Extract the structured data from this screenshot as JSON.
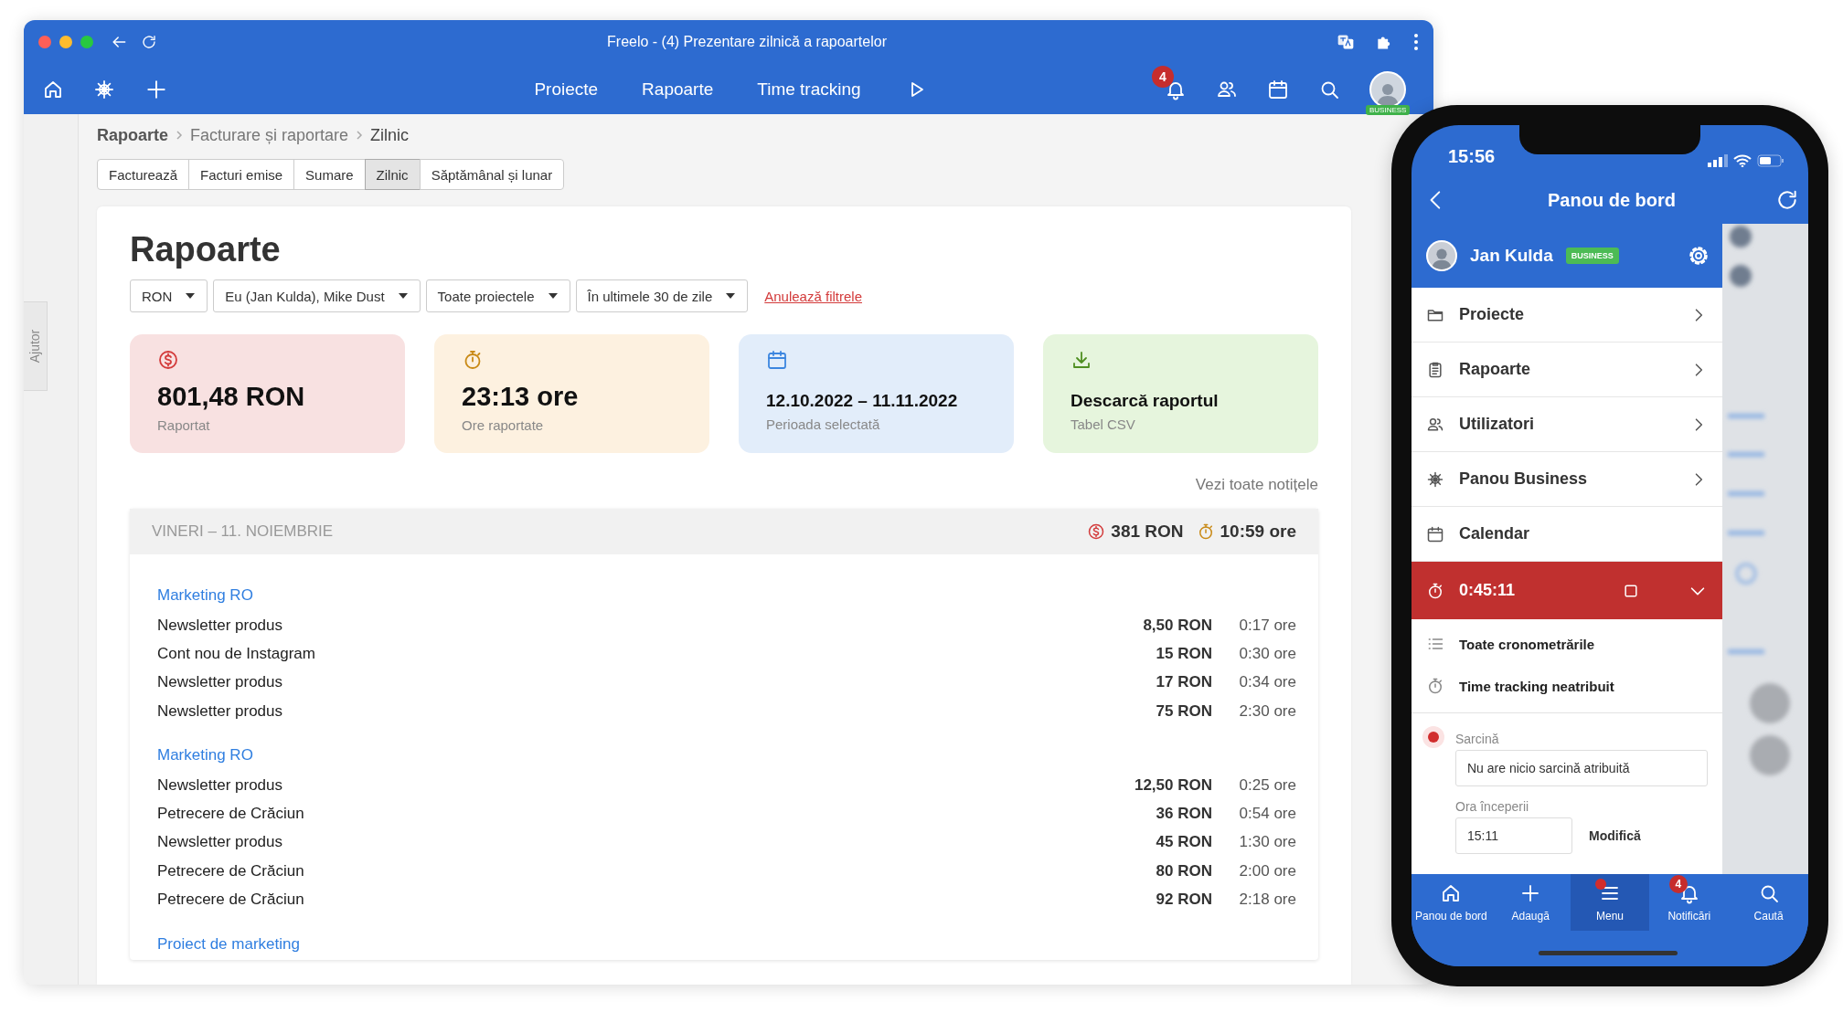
{
  "browser": {
    "title": "Freelo - (4) Prezentare zilnică a rapoartelor",
    "nav": [
      {
        "label": "Proiecte"
      },
      {
        "label": "Rapoarte"
      },
      {
        "label": "Time tracking"
      }
    ],
    "notification_badge": "4",
    "avatar_badge": "BUSINESS"
  },
  "help_tab": "Ajutor",
  "breadcrumb": [
    "Rapoarte",
    "Facturare și raportare",
    "Zilnic"
  ],
  "tabs": [
    {
      "label": "Facturează",
      "selected": false
    },
    {
      "label": "Facturi emise",
      "selected": false
    },
    {
      "label": "Sumare",
      "selected": false
    },
    {
      "label": "Zilnic",
      "selected": true
    },
    {
      "label": "Săptămânal și lunar",
      "selected": false
    }
  ],
  "page": {
    "title": "Rapoarte",
    "filters": [
      {
        "label": "RON"
      },
      {
        "label": "Eu (Jan Kulda), Mike Dust"
      },
      {
        "label": "Toate proiectele"
      },
      {
        "label": "În ultimele 30 de zile"
      }
    ],
    "clear_filters": "Anulează filtrele",
    "stats": [
      {
        "kind": "money",
        "value": "801,48 RON",
        "label": "Raportat"
      },
      {
        "kind": "time",
        "value": "23:13 ore",
        "label": "Ore raportate"
      },
      {
        "kind": "period",
        "value": "12.10.2022 – 11.11.2022",
        "label": "Perioada selectată"
      },
      {
        "kind": "download",
        "value": "Descarcă raportul",
        "label": "Tabel CSV"
      }
    ],
    "notes_link": "Vezi toate notițele",
    "day": {
      "title": "VINERI – 11. NOIEMBRIE",
      "total_money": "381 RON",
      "total_time": "10:59 ore",
      "groups": [
        {
          "project": "Marketing RO",
          "entries": [
            {
              "task": "Newsletter produs",
              "amount": "8,50 RON",
              "time": "0:17 ore"
            },
            {
              "task": "Cont nou de Instagram",
              "amount": "15 RON",
              "time": "0:30 ore"
            },
            {
              "task": "Newsletter produs",
              "amount": "17 RON",
              "time": "0:34 ore"
            },
            {
              "task": "Newsletter produs",
              "amount": "75 RON",
              "time": "2:30 ore"
            }
          ]
        },
        {
          "project": "Marketing RO",
          "entries": [
            {
              "task": "Newsletter produs",
              "amount": "12,50 RON",
              "time": "0:25 ore"
            },
            {
              "task": "Petrecere de Crăciun",
              "amount": "36 RON",
              "time": "0:54 ore"
            },
            {
              "task": "Newsletter produs",
              "amount": "45 RON",
              "time": "1:30 ore"
            },
            {
              "task": "Petrecere de Crăciun",
              "amount": "80 RON",
              "time": "2:00 ore"
            },
            {
              "task": "Petrecere de Crăciun",
              "amount": "92 RON",
              "time": "2:18 ore"
            }
          ]
        },
        {
          "project": "Proiect de marketing"
        }
      ]
    }
  },
  "phone": {
    "status_time": "15:56",
    "header_title": "Panou de bord",
    "user": {
      "name": "Jan Kulda",
      "badge": "BUSINESS"
    },
    "menu": [
      {
        "kind": "folder",
        "label": "Proiecte",
        "chevron": true
      },
      {
        "kind": "report",
        "label": "Rapoarte",
        "chevron": true
      },
      {
        "kind": "users",
        "label": "Utilizatori",
        "chevron": true
      },
      {
        "kind": "business",
        "label": "Panou Business",
        "chevron": true
      },
      {
        "kind": "calendar",
        "label": "Calendar",
        "chevron": false
      }
    ],
    "timer": {
      "value": "0:45:11"
    },
    "timer_links": [
      {
        "kind": "list",
        "label": "Toate cronometrările"
      },
      {
        "kind": "stopwatch",
        "label": "Time tracking neatribuit"
      }
    ],
    "task": {
      "label": "Sarcină",
      "value": "Nu are nicio sarcină atribuită"
    },
    "start": {
      "label": "Ora începerii",
      "value": "15:11",
      "action": "Modifică"
    },
    "tab_bar": [
      {
        "kind": "home",
        "label": "Panou de bord",
        "selected": false,
        "dot": false
      },
      {
        "kind": "plus",
        "label": "Adaugă",
        "selected": false,
        "dot": false
      },
      {
        "kind": "menu",
        "label": "Menu",
        "selected": true,
        "dot": true
      },
      {
        "kind": "bell",
        "label": "Notificări",
        "selected": false,
        "dot": false,
        "badge": "4"
      },
      {
        "kind": "search",
        "label": "Caută",
        "selected": false,
        "dot": false
      }
    ]
  }
}
